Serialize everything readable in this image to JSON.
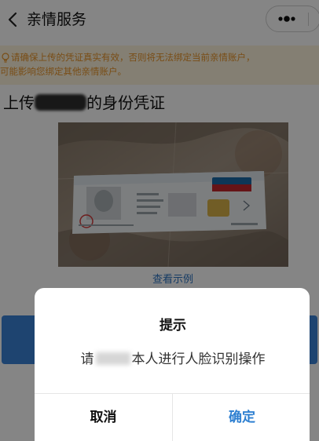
{
  "nav": {
    "title": "亲情服务",
    "back_icon": "chevron-left-icon",
    "more_icon": "more-dots-icon"
  },
  "notice": {
    "line1": "请确保上传的凭证真实有效，否则将无法绑定当前亲情账户，",
    "line2": "可能影响您绑定其他亲情账户。",
    "color": "#e8942a",
    "background": "#fdf3dc",
    "icon": "lightbulb-icon"
  },
  "heading": {
    "prefix": "上传",
    "suffix": "的身份凭证"
  },
  "example_link": "查看示例",
  "dialog": {
    "title": "提示",
    "message_prefix": "请",
    "message_suffix": "本人进行人脸识别操作",
    "cancel_label": "取消",
    "confirm_label": "确定",
    "confirm_color": "#2f80d1"
  },
  "colors": {
    "primary_button": "#3b82d6",
    "link": "#2d74c2"
  }
}
